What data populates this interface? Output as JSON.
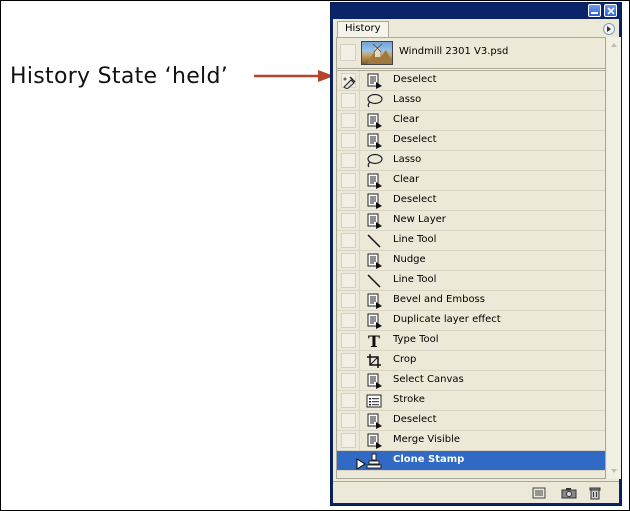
{
  "annotation": {
    "text": "History State ‘held’",
    "arrow_color": "#b5442c"
  },
  "panel": {
    "tab_label": "History",
    "snapshot": {
      "label": "Windmill 2301 V3.psd",
      "thumbnail_icon": "image-thumbnail"
    },
    "states": [
      {
        "label": "Deselect",
        "icon": "document-step-icon",
        "held": true
      },
      {
        "label": "Lasso",
        "icon": "lasso-icon"
      },
      {
        "label": "Clear",
        "icon": "document-step-icon"
      },
      {
        "label": "Deselect",
        "icon": "document-step-icon"
      },
      {
        "label": "Lasso",
        "icon": "lasso-icon"
      },
      {
        "label": "Clear",
        "icon": "document-step-icon"
      },
      {
        "label": "Deselect",
        "icon": "document-step-icon"
      },
      {
        "label": "New Layer",
        "icon": "document-step-icon"
      },
      {
        "label": "Line Tool",
        "icon": "line-tool-icon"
      },
      {
        "label": "Nudge",
        "icon": "document-step-icon"
      },
      {
        "label": "Line Tool",
        "icon": "line-tool-icon"
      },
      {
        "label": "Bevel and Emboss",
        "icon": "document-step-icon"
      },
      {
        "label": "Duplicate layer effect",
        "icon": "document-step-icon"
      },
      {
        "label": "Type Tool",
        "icon": "type-tool-icon"
      },
      {
        "label": "Crop",
        "icon": "crop-icon"
      },
      {
        "label": "Select Canvas",
        "icon": "document-step-icon"
      },
      {
        "label": "Stroke",
        "icon": "list-step-icon"
      },
      {
        "label": "Deselect",
        "icon": "document-step-icon"
      },
      {
        "label": "Merge Visible",
        "icon": "document-step-icon"
      },
      {
        "label": "Clone Stamp",
        "icon": "clone-stamp-icon",
        "selected": true
      }
    ],
    "selected_color": "#316ac5",
    "titlebar_color": "#0a246a"
  }
}
